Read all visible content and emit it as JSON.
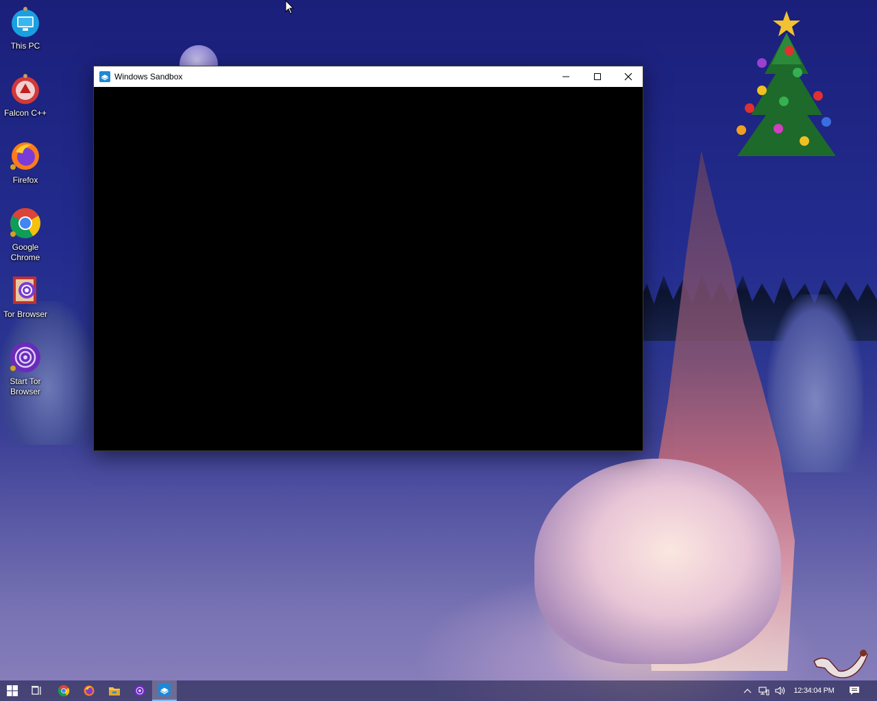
{
  "desktop": {
    "icons": [
      {
        "label": "This PC",
        "icon": "this-pc-icon"
      },
      {
        "label": "Falcon C++",
        "icon": "falcon-cpp-icon"
      },
      {
        "label": "Firefox",
        "icon": "firefox-icon"
      },
      {
        "label": "Google Chrome",
        "icon": "chrome-icon"
      },
      {
        "label": "Tor Browser",
        "icon": "tor-browser-icon"
      },
      {
        "label": "Start Tor Browser",
        "icon": "start-tor-browser-icon"
      }
    ]
  },
  "window": {
    "title": "Windows Sandbox",
    "icon": "windows-sandbox-icon"
  },
  "taskbar": {
    "items": [
      {
        "name": "start",
        "icon": "windows-logo-icon"
      },
      {
        "name": "task-view",
        "icon": "task-view-icon"
      },
      {
        "name": "chrome",
        "icon": "chrome-icon"
      },
      {
        "name": "firefox",
        "icon": "firefox-icon"
      },
      {
        "name": "file-explorer",
        "icon": "folder-icon"
      },
      {
        "name": "tor-browser",
        "icon": "tor-icon"
      },
      {
        "name": "windows-sandbox",
        "icon": "windows-sandbox-icon",
        "active": true
      }
    ],
    "tray": {
      "time": "12:34:04 PM"
    }
  },
  "colors": {
    "titlebar": "#ffffff",
    "window_client": "#000000",
    "taskbar_active_indicator": "#7fb6ff"
  }
}
